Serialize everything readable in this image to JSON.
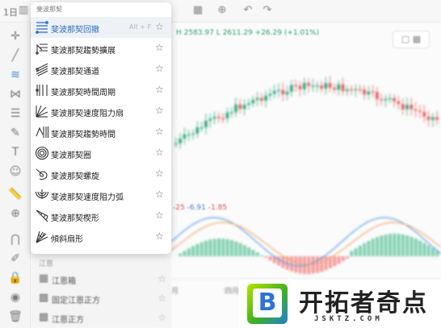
{
  "toolbar": {
    "label": "1日"
  },
  "chart": {
    "legend_prefix": "",
    "legend_values": "H 2583.97  L 2611.29 +26.29 (+1.01%)",
    "oscillator_values": [
      "-25",
      "-6.91",
      "-1.85"
    ],
    "colors": {
      "up": "#2fa779",
      "down": "#e25c5c",
      "ma_blue": "#5b9be6",
      "ma_orange": "#f2a76a",
      "hist_green": "#7fcfb0",
      "hist_red": "#f29a9a"
    },
    "bottom_labels": [
      "月",
      "四月"
    ]
  },
  "menu": {
    "header": "斐波那契",
    "items": [
      {
        "label": "斐波那契回撤",
        "shortcut": "Alt + F",
        "icon": "fib-retracement-icon",
        "highlighted": true
      },
      {
        "label": "斐波那契趨勢擴展",
        "shortcut": "",
        "icon": "fib-trend-extension-icon"
      },
      {
        "label": "斐波那契通道",
        "shortcut": "",
        "icon": "fib-channel-icon"
      },
      {
        "label": "斐波那契時間周期",
        "shortcut": "",
        "icon": "fib-time-zone-icon"
      },
      {
        "label": "斐波那契速度阻力扇",
        "shortcut": "",
        "icon": "fib-speed-fan-icon"
      },
      {
        "label": "斐波那契趨勢時間",
        "shortcut": "",
        "icon": "fib-trend-time-icon"
      },
      {
        "label": "斐波那契圈",
        "shortcut": "",
        "icon": "fib-circles-icon"
      },
      {
        "label": "斐波那契螺旋",
        "shortcut": "",
        "icon": "fib-spiral-icon"
      },
      {
        "label": "斐波那契速度阻力弧",
        "shortcut": "",
        "icon": "fib-speed-arcs-icon"
      },
      {
        "label": "斐波那契楔形",
        "shortcut": "",
        "icon": "fib-wedge-icon"
      },
      {
        "label": "傾斜扇形",
        "shortcut": "",
        "icon": "pitchfan-icon"
      }
    ]
  },
  "lower_list": {
    "section": "江恩",
    "items": [
      {
        "label": "江恩箱",
        "icon": "gann-box-icon"
      },
      {
        "label": "固定江恩正方",
        "icon": "gann-square-fixed-icon"
      },
      {
        "label": "江恩正方",
        "icon": "gann-square-icon"
      }
    ]
  },
  "watermark": {
    "logo_letter": "B",
    "title": "开拓者奇点",
    "url": "JSKTZ.COM"
  }
}
